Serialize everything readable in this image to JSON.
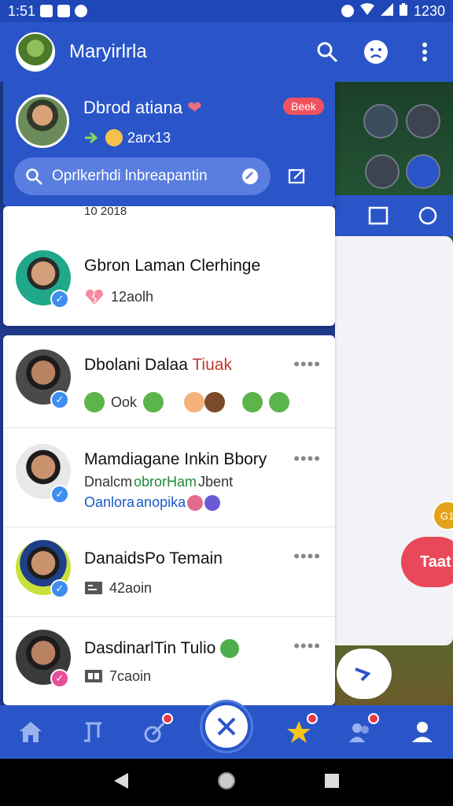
{
  "statusbar": {
    "time": "1:51",
    "right_text": "1230"
  },
  "appbar": {
    "title": "Maryirlrla",
    "search_icon": "search-icon",
    "profile_icon": "sad-face-icon",
    "menu_icon": "kebab-menu-icon"
  },
  "drawer": {
    "name": "Dbrod atiana",
    "heart": "❤",
    "sub_text": "2arx13",
    "badge": "Beek",
    "search_placeholder": "Oprlkerhdi lnbreapantin"
  },
  "card1": {
    "partial_row_text": "10 2018",
    "rows": [
      {
        "name": "Gbron Laman Clerhinge",
        "meta": "12aolh"
      }
    ]
  },
  "card2": {
    "rows": [
      {
        "name_a": "Dbolani Dalaa ",
        "name_b": "Tiuak",
        "meta": "Ook",
        "more": "••••"
      },
      {
        "name": "Mamdiagane Inkin Bbory",
        "line2_a": "Dnalcm ",
        "line2_b": "obrorHam",
        "line2_c": " Jbent",
        "line3_a": "Oanlora ",
        "line3_b": "anopika",
        "more": "••••"
      },
      {
        "name": "DanaidsPo Temain",
        "meta": "42aoin",
        "more": "••••"
      },
      {
        "name": "DasdinarlTin Tulio",
        "meta": "7caoin",
        "more": "••••"
      }
    ]
  },
  "background": {
    "red_pill": "Taat",
    "gold_badge": "G1"
  },
  "colors": {
    "primary": "#2a55c9",
    "accent_red": "#e9485a",
    "check_blue": "#3e8ef0"
  }
}
